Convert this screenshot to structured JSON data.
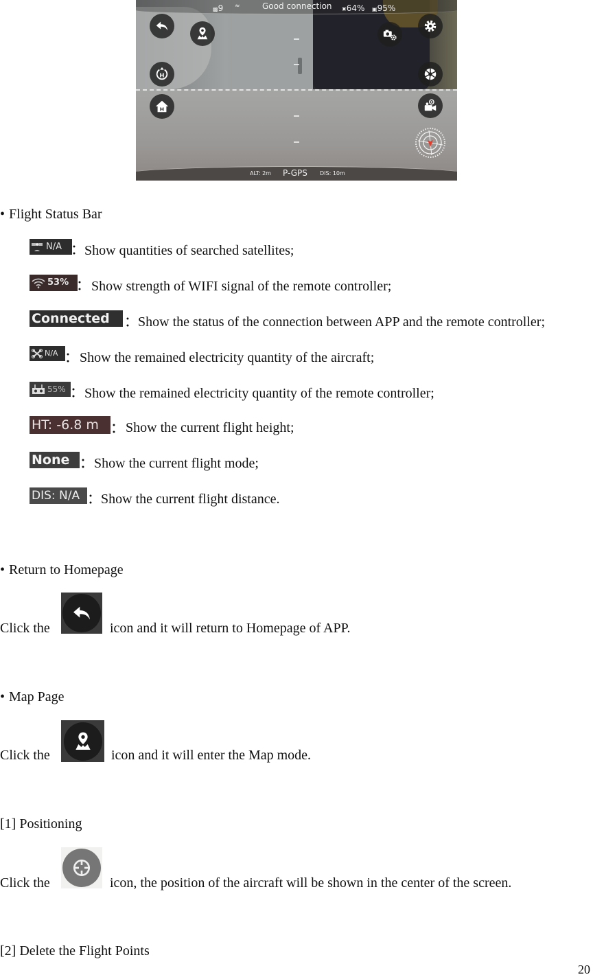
{
  "app_screenshot": {
    "status_bar": {
      "satellites": "9",
      "connection": "Good connection",
      "aircraft_battery": "64%",
      "rc_battery": "95%"
    },
    "bottom_bar": {
      "altitude": "ALT: 2m",
      "flight_mode": "P-GPS",
      "distance": "DIS: 10m"
    },
    "left_buttons": [
      "back-icon",
      "map-icon",
      "takeoff-icon",
      "return-home-icon"
    ],
    "right_buttons": [
      "camera-settings-icon",
      "settings-icon",
      "shutter-icon",
      "video-record-icon",
      "compass-icon"
    ]
  },
  "sections": {
    "flight_status_bar": {
      "heading": "Flight Status Bar",
      "items": [
        {
          "chip": "N/A",
          "icon": "satellite-icon",
          "desc": "Show quantities of searched satellites;"
        },
        {
          "chip": "53%",
          "icon": "wifi-icon",
          "desc": "Show strength of WIFI signal of the remote controller;"
        },
        {
          "chip": "Connected",
          "icon": "",
          "desc": "Show the status of the connection between APP and the remote controller;"
        },
        {
          "chip": "N/A",
          "icon": "drone-icon",
          "desc": "Show the remained electricity quantity of the aircraft;"
        },
        {
          "chip": "55%",
          "icon": "remote-controller-icon",
          "desc": "Show the remained electricity quantity of the remote controller;"
        },
        {
          "chip": "HT: -6.8 m",
          "icon": "",
          "desc": "Show the current flight height;"
        },
        {
          "chip": "None",
          "icon": "",
          "desc": "Show the current flight mode;"
        },
        {
          "chip": "DIS: N/A",
          "icon": "",
          "desc": "Show the current flight distance."
        }
      ],
      "separator": "："
    },
    "return_home": {
      "heading": "Return to Homepage",
      "prefix": "Click the",
      "suffix": "icon and it will return to Homepage of APP."
    },
    "map_page": {
      "heading": "Map Page",
      "prefix": "Click the",
      "suffix": "icon and it will enter the Map mode."
    },
    "positioning": {
      "heading": "[1] Positioning",
      "prefix": "Click the",
      "suffix": "icon, the position of the aircraft will be shown in the center of the screen."
    },
    "delete_points": {
      "heading": "[2] Delete the Flight Points"
    }
  },
  "page_number": "20"
}
